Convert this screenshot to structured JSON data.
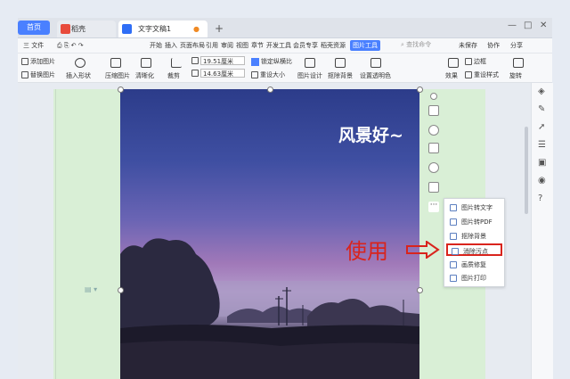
{
  "tabs": {
    "home": "首页",
    "daoke": "稻壳",
    "doc": "文字文稿1",
    "plus": "+"
  },
  "menu": {
    "file": "三 文件",
    "items": [
      "开始",
      "插入",
      "页面布局",
      "引用",
      "审阅",
      "视图",
      "章节",
      "开发工具",
      "会员专享",
      "稻壳资源"
    ],
    "active": "图片工具",
    "search": "查找命令",
    "right": [
      "未保存",
      "协作",
      "分享"
    ]
  },
  "toolbar": {
    "add_pic": "添加图片",
    "replace_pic": "替换图片",
    "insert_shape": "插入形状",
    "compress": "压缩图片",
    "clarify": "清晰化",
    "crop": "裁剪",
    "width": "19.51厘米",
    "height": "14.63厘米",
    "lock_ratio": "锁定纵横比",
    "reset_size": "重设大小",
    "pic_design": "图片设计",
    "cutout": "抠除背景",
    "transparent": "设置透明色",
    "effect": "效果",
    "border": "边框",
    "reset_style": "重设样式",
    "rotate": "旋转"
  },
  "photo": {
    "title": "风景好~"
  },
  "popup": {
    "items": [
      "图片转文字",
      "图片转PDF",
      "抠除背景",
      "消除污点",
      "画质修复",
      "图片打印"
    ],
    "highlighted_index": 3
  },
  "annotation": {
    "text": "使用"
  },
  "colors": {
    "accent": "#4a80ff",
    "annotation": "#d9241d",
    "page": "#d9efd6"
  }
}
